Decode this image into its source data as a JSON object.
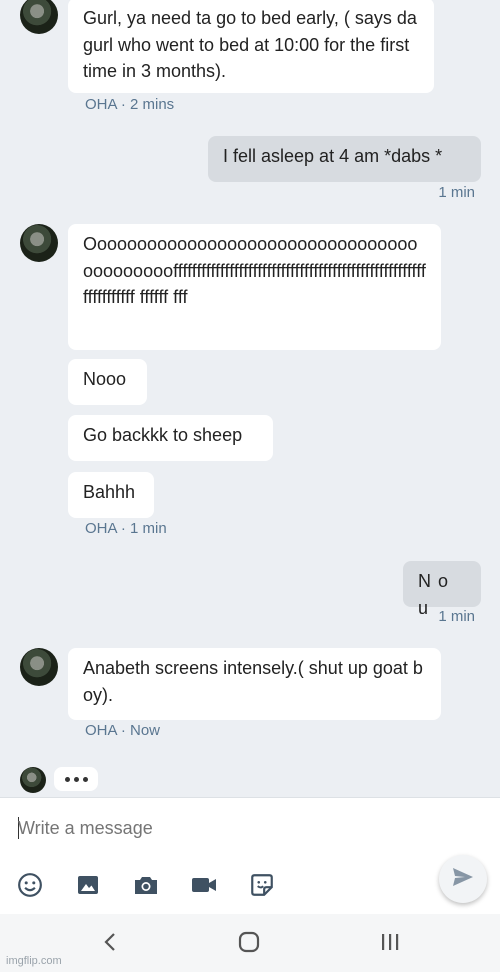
{
  "messages": [
    {
      "side": "in",
      "text": "Gurl, ya need ta go to bed early, ( says da gurl who went to bed at 10:00 for the first time in 3 months)."
    },
    {
      "side": "out",
      "text": "I fell asleep at 4 am *dabs *"
    },
    {
      "side": "in",
      "text": "Oooooooooooooooooooooooooooooooooooooooooofffffffffffffffffffffffffffffffffffffffffffffffffffffffffffffffff ffffff fff"
    },
    {
      "side": "in",
      "text": "Nooo"
    },
    {
      "side": "in",
      "text": "Go backkk to sheep"
    },
    {
      "side": "in",
      "text": "Bahhh"
    },
    {
      "side": "out",
      "text": "N o u"
    },
    {
      "side": "in",
      "text": "Anabeth screens intensely.( shut up goat boy)."
    }
  ],
  "meta": {
    "m1": "OHA · 2 mins",
    "m2": "1 min",
    "m3": "OHA · 1 min",
    "m4": "1 min",
    "m5": "OHA · Now"
  },
  "composer": {
    "placeholder": "Write a message"
  },
  "tools": [
    "emoji-icon",
    "image-icon",
    "camera-icon",
    "video-icon",
    "sticker-icon",
    "send-icon"
  ],
  "nav": [
    "back-icon",
    "home-icon",
    "recents-icon"
  ],
  "watermark": "imgflip.com",
  "colors": {
    "accent": "#5a7690",
    "incoming": "#ffffff",
    "outgoing": "#d7dbe0"
  }
}
